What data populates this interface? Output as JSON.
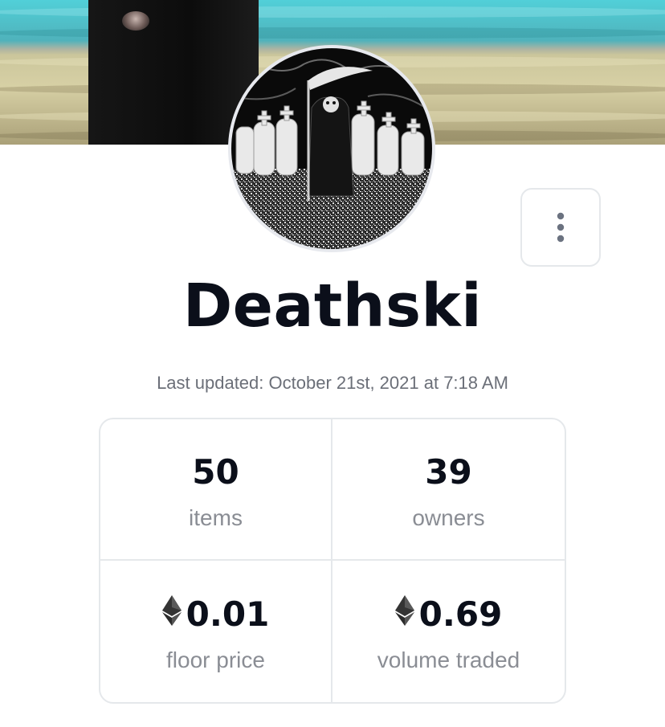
{
  "collection": {
    "name": "Deathski",
    "last_updated": "Last updated: October 21st, 2021 at 7:18 AM"
  },
  "menu": {
    "icon": "more-vertical-icon"
  },
  "stats": [
    {
      "value": "50",
      "label": "items",
      "currency_icon": null
    },
    {
      "value": "39",
      "label": "owners",
      "currency_icon": null
    },
    {
      "value": "0.01",
      "label": "floor price",
      "currency_icon": "ethereum-icon"
    },
    {
      "value": "0.69",
      "label": "volume traded",
      "currency_icon": "ethereum-icon"
    }
  ],
  "colors": {
    "title": "#0b0f1a",
    "muted_text": "#6b6f78",
    "border": "#e5e8eb"
  }
}
